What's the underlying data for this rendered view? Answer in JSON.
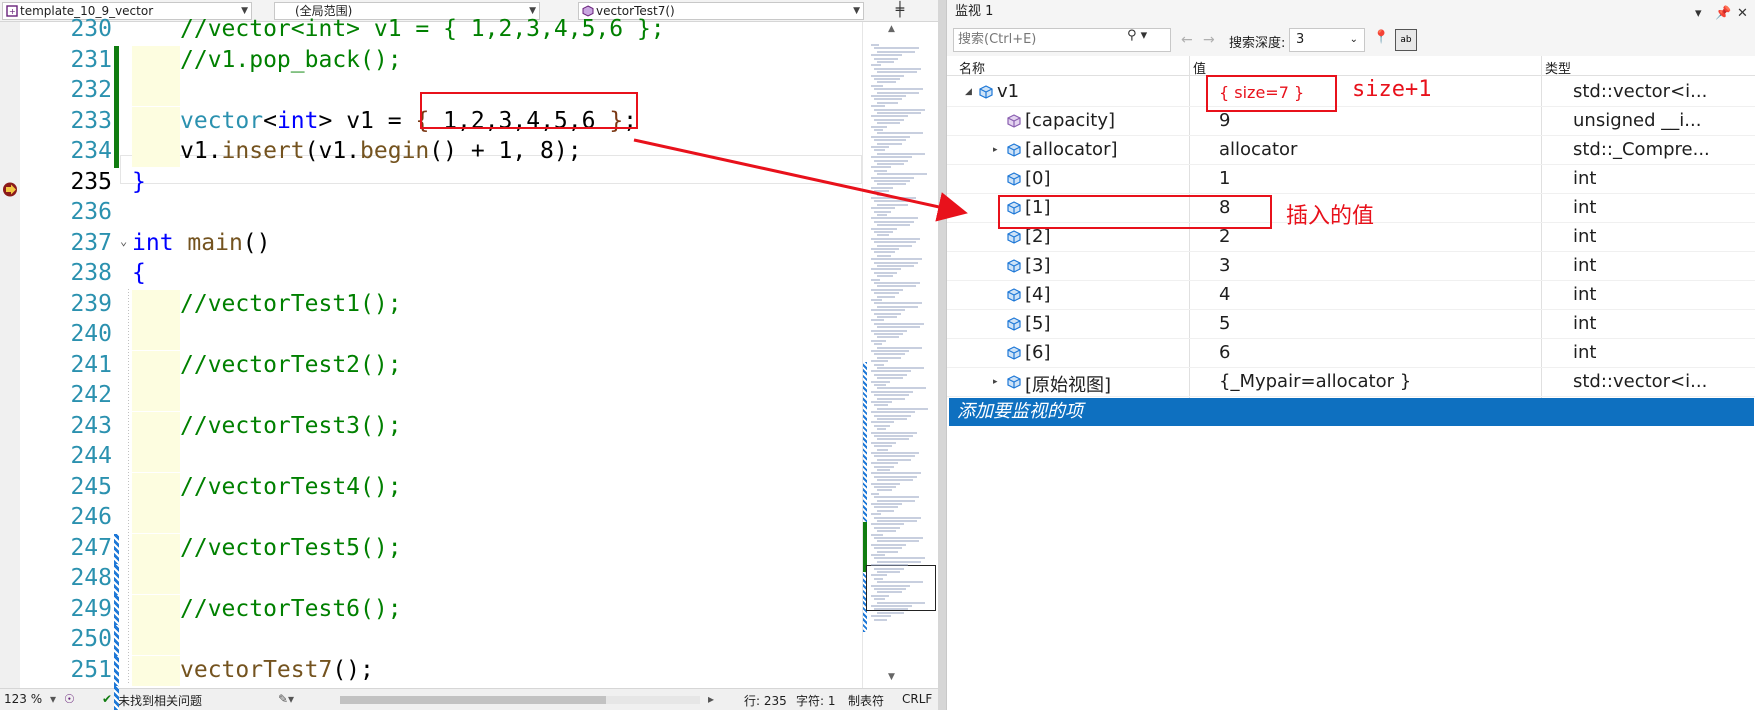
{
  "editor": {
    "nav": {
      "project": "template_10_9_vector",
      "scope": "(全局范围)",
      "function": "vectorTest7()"
    },
    "lines": [
      {
        "num": "230",
        "text": "//vector<int> v1 = { 1,2,3,4,5,6 };"
      },
      {
        "num": "231",
        "text": "//v1.pop_back();"
      },
      {
        "num": "232",
        "text": ""
      },
      {
        "num": "233",
        "tokens": [
          [
            "ty",
            "vector"
          ],
          [
            "pl",
            "<"
          ],
          [
            "kw",
            "int"
          ],
          [
            "pl",
            "> v1 = "
          ],
          [
            "br2",
            "{"
          ],
          [
            "pl",
            " 1,2,3,4,5,6 "
          ],
          [
            "br2",
            "}"
          ],
          [
            "pl",
            ";"
          ]
        ]
      },
      {
        "num": "234",
        "tokens": [
          [
            "pl",
            "v1."
          ],
          [
            "fn",
            "insert"
          ],
          [
            "pl",
            "(v1."
          ],
          [
            "fn",
            "begin"
          ],
          [
            "pl",
            "() + 1, 8);"
          ]
        ]
      },
      {
        "num": "235",
        "tokens": [
          [
            "br1",
            "}"
          ]
        ]
      },
      {
        "num": "236",
        "text": ""
      },
      {
        "num": "237",
        "tokens": [
          [
            "kw",
            "int"
          ],
          [
            "pl",
            " "
          ],
          [
            "fn",
            "main"
          ],
          [
            "pl",
            "()"
          ]
        ]
      },
      {
        "num": "238",
        "tokens": [
          [
            "br1",
            "{"
          ]
        ]
      },
      {
        "num": "239",
        "text": "//vectorTest1();"
      },
      {
        "num": "240",
        "text": ""
      },
      {
        "num": "241",
        "text": "//vectorTest2();"
      },
      {
        "num": "242",
        "text": ""
      },
      {
        "num": "243",
        "text": "//vectorTest3();"
      },
      {
        "num": "244",
        "text": ""
      },
      {
        "num": "245",
        "text": "//vectorTest4();"
      },
      {
        "num": "246",
        "text": ""
      },
      {
        "num": "247",
        "text": "//vectorTest5();"
      },
      {
        "num": "248",
        "text": ""
      },
      {
        "num": "249",
        "text": "//vectorTest6();"
      },
      {
        "num": "250",
        "text": ""
      },
      {
        "num": "251",
        "tokens": [
          [
            "fn",
            "vectorTest7"
          ],
          [
            "pl",
            "();"
          ]
        ]
      },
      {
        "num": "252",
        "text": ""
      }
    ],
    "current_line": "235"
  },
  "status": {
    "zoom": "123 %",
    "issues": "未找到相关问题",
    "line": "行: 235",
    "col": "字符: 1",
    "tab": "制表符",
    "eol": "CRLF"
  },
  "watch": {
    "title": "监视 1",
    "search_placeholder": "搜索(Ctrl+E)",
    "depth_label": "搜索深度:",
    "depth_value": "3",
    "col_name": "名称",
    "col_value": "值",
    "col_type": "类型",
    "rows": [
      {
        "name": "v1",
        "value": "{ size=7 }",
        "type": "std::vector<i...",
        "indent": 0,
        "exp": "open",
        "icon": "object"
      },
      {
        "name": "[capacity]",
        "value": "9",
        "type": "unsigned __i...",
        "indent": 1,
        "exp": "none",
        "icon": "property"
      },
      {
        "name": "[allocator]",
        "value": "allocator",
        "type": "std::_Compre...",
        "indent": 1,
        "exp": "closed",
        "icon": "object"
      },
      {
        "name": "[0]",
        "value": "1",
        "type": "int",
        "indent": 1,
        "exp": "none",
        "icon": "object"
      },
      {
        "name": "[1]",
        "value": "8",
        "type": "int",
        "indent": 1,
        "exp": "none",
        "icon": "object"
      },
      {
        "name": "[2]",
        "value": "2",
        "type": "int",
        "indent": 1,
        "exp": "none",
        "icon": "object"
      },
      {
        "name": "[3]",
        "value": "3",
        "type": "int",
        "indent": 1,
        "exp": "none",
        "icon": "object"
      },
      {
        "name": "[4]",
        "value": "4",
        "type": "int",
        "indent": 1,
        "exp": "none",
        "icon": "object"
      },
      {
        "name": "[5]",
        "value": "5",
        "type": "int",
        "indent": 1,
        "exp": "none",
        "icon": "object"
      },
      {
        "name": "[6]",
        "value": "6",
        "type": "int",
        "indent": 1,
        "exp": "none",
        "icon": "object"
      },
      {
        "name": "[原始视图]",
        "value": "{_Mypair=allocator }",
        "type": "std::vector<i...",
        "indent": 1,
        "exp": "closed",
        "icon": "object"
      }
    ],
    "add_item": "添加要监视的项"
  },
  "annotations": {
    "size_note": "size+1",
    "insert_note": "插入的值"
  },
  "colors": {
    "accent": "#0e70c0",
    "annotation": "#e8111b",
    "comment": "#008000",
    "keyword": "#0000ff",
    "type": "#2b91af"
  }
}
